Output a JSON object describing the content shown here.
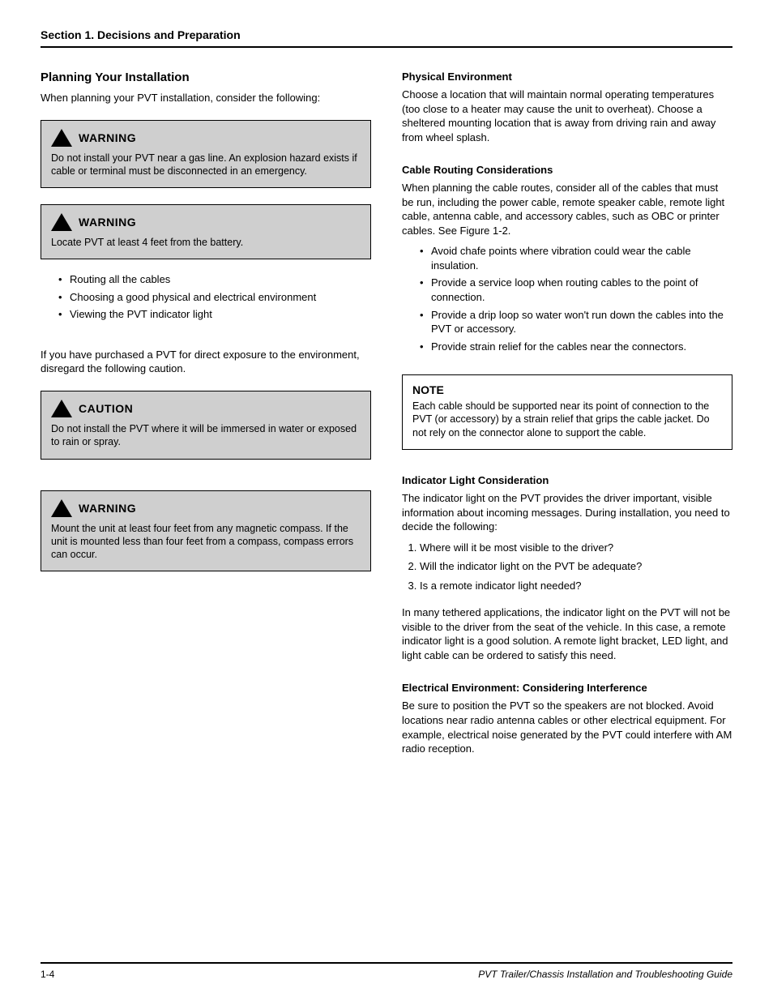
{
  "page_title": "Section 1.  Decisions and Preparation",
  "left": {
    "heading": "Planning Your Installation",
    "intro_p1": "When planning your PVT installation, consider the following:",
    "warning1": {
      "title": "WARNING",
      "body": "Do not install your PVT near a gas line. An explosion hazard exists if cable or terminal must be disconnected in an emergency."
    },
    "warning2": {
      "title": "WARNING",
      "body": "Locate PVT at least 4 feet from the battery."
    },
    "factors": [
      "Routing all the cables",
      "Choosing a good physical and electrical environment",
      "Viewing the PVT indicator light"
    ],
    "apply_type_line": "If you have purchased a PVT for direct exposure to the environment, disregard the following caution.",
    "caution1": {
      "title": "CAUTION",
      "body": "Do not install the PVT where it will be immersed in water or exposed to rain or spray."
    },
    "warning3": {
      "title": "WARNING",
      "body": "Mount the unit at least four feet from any magnetic compass. If the unit is mounted less than four feet from a compass, compass errors can occur."
    }
  },
  "right": {
    "physical_env_heading": "Physical Environment",
    "physical_env_body": "Choose a location that will maintain normal operating temperatures (too close to a heater may cause the unit to overheat). Choose a sheltered mounting location that is away from driving rain and away from wheel splash.",
    "cable_routing_heading": "Cable Routing Considerations",
    "cable_routing_body": "When planning the cable routes, consider all of the cables that must be run, including the power cable, remote speaker cable, remote light cable, antenna cable, and accessory cables, such as OBC or printer cables. See Figure 1-2.",
    "cable_bullets": [
      "Avoid chafe points where vibration could wear the cable insulation.",
      "Provide a service loop when routing cables to the point of connection.",
      "Provide a drip loop so water won't run down the cables into the PVT or accessory.",
      "Provide strain relief for the cables near the connectors."
    ],
    "note": {
      "title": "NOTE",
      "body": "Each cable should be supported near its point of connection to the PVT (or accessory) by a strain relief that grips the cable jacket. Do not rely on the connector alone to support the cable."
    },
    "indicator_heading": "Indicator Light Consideration",
    "indicator_body1": "The indicator light on the PVT provides the driver important, visible information about incoming messages. During installation, you need to decide the following:",
    "indicator_items": [
      "Where will it be most visible to the driver?",
      "Will the indicator light on the PVT be adequate?",
      "Is a remote indicator light needed?"
    ],
    "indicator_body2": "In many tethered applications, the indicator light on the PVT will not be visible to the driver from the seat of the vehicle. In this case, a remote indicator light is a good solution. A remote light bracket, LED light, and light cable can be ordered to satisfy this need.",
    "electrical_heading": "Electrical Environment: Considering Interference",
    "electrical_body": "Be sure to position the PVT so the speakers are not blocked. Avoid locations near radio antenna cables or other electrical equipment. For example, electrical noise generated by the PVT could interfere with AM radio reception."
  },
  "footer": {
    "page_num": "1-4",
    "doc_title": "PVT Trailer/Chassis Installation and Troubleshooting Guide"
  }
}
